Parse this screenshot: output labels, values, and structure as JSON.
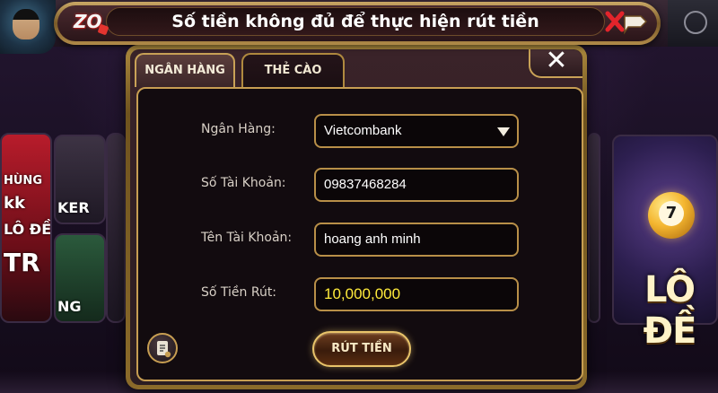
{
  "banner": {
    "message": "Số tiền không đủ để thực hiện rút tiền",
    "logo_text": "ZO"
  },
  "tabs": [
    {
      "label": "NGÂN HÀNG",
      "active": true
    },
    {
      "label": "THẺ CÀO",
      "active": false
    }
  ],
  "form": {
    "bank": {
      "label": "Ngân Hàng:",
      "value": "Vietcombank"
    },
    "account_number": {
      "label": "Số Tài Khoản:",
      "value": "09837468284"
    },
    "account_name": {
      "label": "Tên Tài Khoản:",
      "value": "hoang anh minh"
    },
    "amount": {
      "label": "Số Tiền Rút:",
      "value": "10,000,000"
    },
    "submit_label": "RÚT TIỀN"
  },
  "close_glyph": "✕",
  "background": {
    "left_cards": [
      "HÙNG",
      "kk",
      "LÔ ĐỀ",
      "TR",
      "KER",
      "NG"
    ],
    "lotto_ball": "7",
    "lotto_text": "LÔ ĐỀ"
  },
  "colors": {
    "gold_border": "#c79e52",
    "amount_text": "#ffeb3b",
    "panel_bg": "#120b0f"
  }
}
